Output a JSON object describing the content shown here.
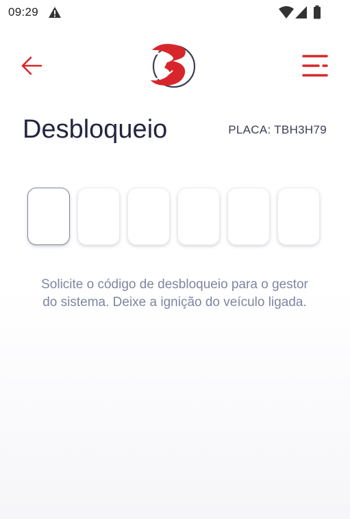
{
  "status_bar": {
    "time": "09:29"
  },
  "header": {
    "back_icon": "arrow-left-icon",
    "logo_icon": "brand-logo-icon",
    "menu_icon": "menu-icon"
  },
  "page": {
    "title": "Desbloqueio",
    "plate": "PLACA: TBH3H79"
  },
  "code_input": {
    "length": 6,
    "values": [
      "",
      "",
      "",
      "",
      "",
      ""
    ]
  },
  "hint": "Solicite o código de desbloqueio para o gestor do sistema. Deixe a ignição do veículo ligada.",
  "colors": {
    "accent": "#d7262b",
    "title": "#23253f",
    "hint": "#7e86a0"
  }
}
